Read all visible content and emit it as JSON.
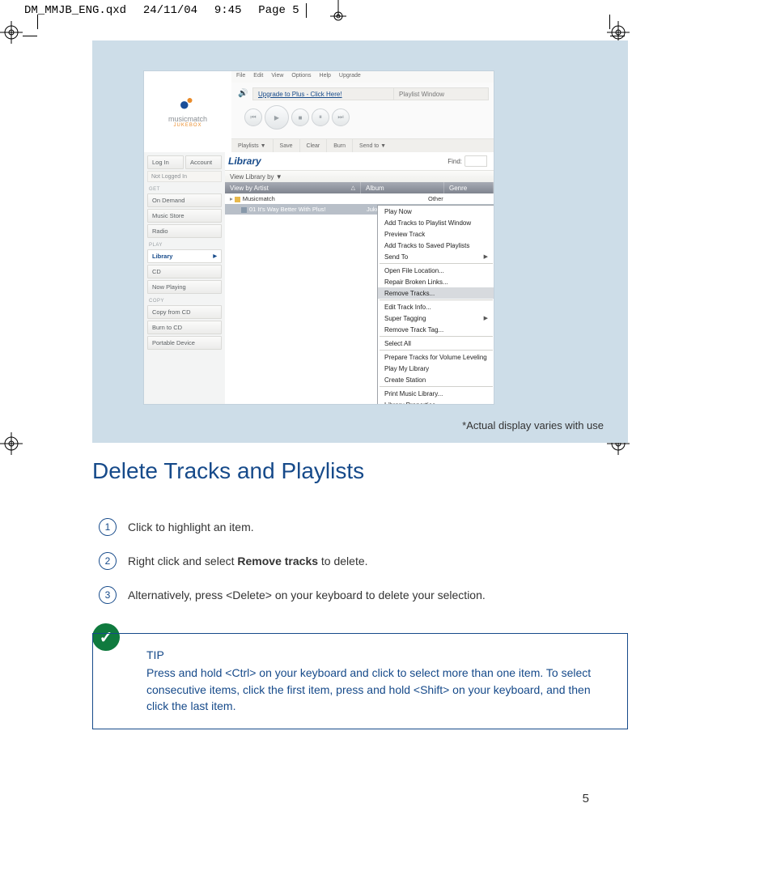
{
  "slug": {
    "file": "DM_MMJB_ENG.qxd",
    "date": "24/11/04",
    "time": "9:45",
    "page": "Page 5"
  },
  "pageNumber": "5",
  "note": "*Actual display varies with use",
  "heading": "Delete Tracks and Playlists",
  "steps": [
    {
      "n": "1",
      "text": "Click to highlight an item."
    },
    {
      "n": "2",
      "pre": "Right click and select ",
      "bold": "Remove tracks",
      "post": " to delete."
    },
    {
      "n": "3",
      "text": "Alternatively, press <Delete> on your keyboard to delete your selection."
    }
  ],
  "tip": {
    "title": "TIP",
    "body": "Press and hold <Ctrl> on your keyboard and click to select more than one item. To select consecutive items, click the first item, press and hold <Shift> on your keyboard, and then click the last item."
  },
  "app": {
    "logo": {
      "name": "musicmatch",
      "sub": "JUKEBOX"
    },
    "menubar": [
      "File",
      "Edit",
      "View",
      "Options",
      "Help",
      "Upgrade"
    ],
    "upgrade": "Upgrade to Plus - Click Here!",
    "playlistWindow": "Playlist Window",
    "plbar": [
      "Playlists ▼",
      "Save",
      "Clear",
      "Burn",
      "Send to ▼"
    ],
    "auth": {
      "login": "Log In",
      "account": "Account",
      "status": "Not Logged In"
    },
    "sections": {
      "get": {
        "label": "GET",
        "items": [
          "On Demand",
          "Music Store",
          "Radio"
        ]
      },
      "play": {
        "label": "PLAY",
        "items": [
          "Library",
          "CD",
          "Now Playing"
        ]
      },
      "copy": {
        "label": "COPY",
        "items": [
          "Copy from CD",
          "Burn to CD",
          "Portable Device"
        ]
      }
    },
    "libraryTab": "Library",
    "find": "Find:",
    "viewBy": "View Library by ▼",
    "columns": {
      "c1": "View by Artist",
      "c2": "Album",
      "c3": "Genre"
    },
    "rows": [
      {
        "artist": "Musicmatch",
        "album": "",
        "genre": "Other"
      },
      {
        "artist": "01 It's Way Better With Plus!",
        "album": "Jukebox Plus",
        "genre": ""
      }
    ],
    "context": [
      {
        "t": "Play Now"
      },
      {
        "t": "Add Tracks to Playlist Window"
      },
      {
        "t": "Preview Track"
      },
      {
        "t": "Add Tracks to Saved Playlists"
      },
      {
        "t": "Send To",
        "sub": true
      },
      {
        "sep": true
      },
      {
        "t": "Open File Location..."
      },
      {
        "t": "Repair Broken Links..."
      },
      {
        "t": "Remove Tracks...",
        "hi": true
      },
      {
        "sep": true
      },
      {
        "t": "Edit Track Info..."
      },
      {
        "t": "Super Tagging",
        "sub": true
      },
      {
        "t": "Remove Track Tag..."
      },
      {
        "sep": true
      },
      {
        "t": "Select All"
      },
      {
        "sep": true
      },
      {
        "t": "Prepare Tracks for Volume Leveling"
      },
      {
        "t": "Play My Library"
      },
      {
        "t": "Create Station"
      },
      {
        "sep": true
      },
      {
        "t": "Print Music Library..."
      },
      {
        "t": "Library Properties..."
      }
    ]
  }
}
